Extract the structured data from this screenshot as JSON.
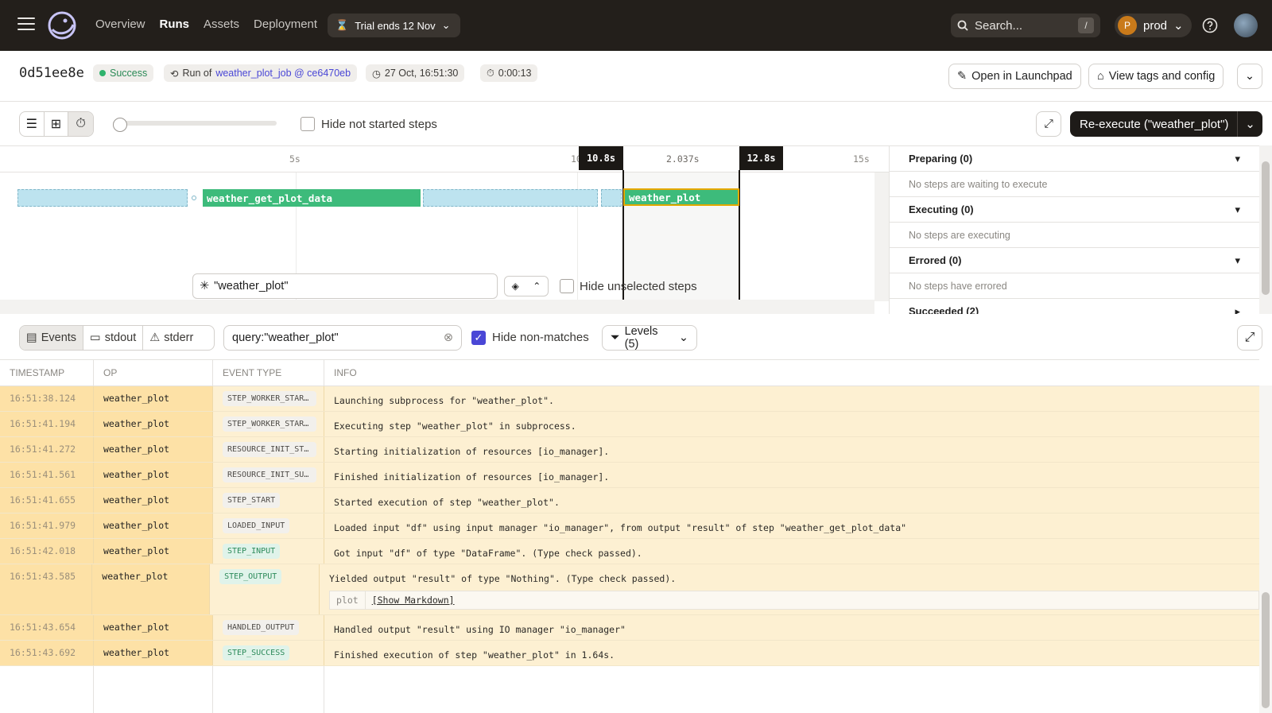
{
  "nav": {
    "links": [
      "Overview",
      "Runs",
      "Assets",
      "Deployment"
    ],
    "active": "Runs",
    "trial": "Trial ends 12 Nov",
    "search_placeholder": "Search...",
    "search_shortcut": "/",
    "deployment_initial": "P",
    "deployment": "prod"
  },
  "run": {
    "id": "0d51ee8e",
    "status": "Success",
    "job_prefix": "Run of",
    "job": "weather_plot_job @ ce6470eb",
    "start": "27 Oct, 16:51:30",
    "duration": "0:00:13",
    "open_launchpad": "Open in Launchpad",
    "view_tags": "View tags and config"
  },
  "toolbar": {
    "hide_not_started": "Hide not started steps",
    "reexecute": "Re-execute (\"weather_plot\")"
  },
  "gantt": {
    "ticks": [
      "5s",
      "10",
      "15s"
    ],
    "marker_start": "10.8s",
    "marker_duration": "2.037s",
    "marker_end": "12.8s",
    "steps": [
      "weather_get_plot_data",
      "weather_plot"
    ],
    "selection_query": "\"weather_plot\"",
    "hide_unselected": "Hide unselected steps"
  },
  "status_panel": [
    {
      "head": "Preparing (0)",
      "body": "No steps are waiting to execute"
    },
    {
      "head": "Executing (0)",
      "body": "No steps are executing"
    },
    {
      "head": "Errored (0)",
      "body": "No steps have errored"
    },
    {
      "head": "Succeeded (2)",
      "body": ""
    }
  ],
  "logs": {
    "tabs": [
      "Events",
      "stdout",
      "stderr"
    ],
    "query": "query:\"weather_plot\"",
    "hide_non_matches": "Hide non-matches",
    "levels": "Levels (5)",
    "columns": [
      "TIMESTAMP",
      "OP",
      "EVENT TYPE",
      "INFO"
    ],
    "rows": [
      {
        "ts": "16:51:38.124",
        "op": "weather_plot",
        "type": "STEP_WORKER_STARTING",
        "info": "Launching subprocess for \"weather_plot\"."
      },
      {
        "ts": "16:51:41.194",
        "op": "weather_plot",
        "type": "STEP_WORKER_STARTED",
        "info": "Executing step \"weather_plot\" in subprocess."
      },
      {
        "ts": "16:51:41.272",
        "op": "weather_plot",
        "type": "RESOURCE_INIT_STARTED",
        "info": "Starting initialization of resources [io_manager]."
      },
      {
        "ts": "16:51:41.561",
        "op": "weather_plot",
        "type": "RESOURCE_INIT_SUCCESS",
        "info": "Finished initialization of resources [io_manager]."
      },
      {
        "ts": "16:51:41.655",
        "op": "weather_plot",
        "type": "STEP_START",
        "info": "Started execution of step \"weather_plot\"."
      },
      {
        "ts": "16:51:41.979",
        "op": "weather_plot",
        "type": "LOADED_INPUT",
        "info": "Loaded input \"df\" using input manager \"io_manager\", from output \"result\" of step \"weather_get_plot_data\""
      },
      {
        "ts": "16:51:42.018",
        "op": "weather_plot",
        "type": "STEP_INPUT",
        "info": "Got input \"df\" of type \"DataFrame\". (Type check passed)."
      },
      {
        "ts": "16:51:43.585",
        "op": "weather_plot",
        "type": "STEP_OUTPUT",
        "info": "Yielded output \"result\" of type \"Nothing\". (Type check passed).",
        "meta_key": "plot",
        "meta_val": "[Show Markdown]"
      },
      {
        "ts": "16:51:43.654",
        "op": "weather_plot",
        "type": "HANDLED_OUTPUT",
        "info": "Handled output \"result\" using IO manager \"io_manager\""
      },
      {
        "ts": "16:51:43.692",
        "op": "weather_plot",
        "type": "STEP_SUCCESS",
        "info": "Finished execution of step \"weather_plot\" in 1.64s."
      }
    ]
  },
  "colors": {
    "nav_bg": "#231f1b",
    "success": "#2fb36d",
    "step_done": "#3dbb7b",
    "row_highlight": "#fdf0d2",
    "accent": "#4a47d6"
  }
}
